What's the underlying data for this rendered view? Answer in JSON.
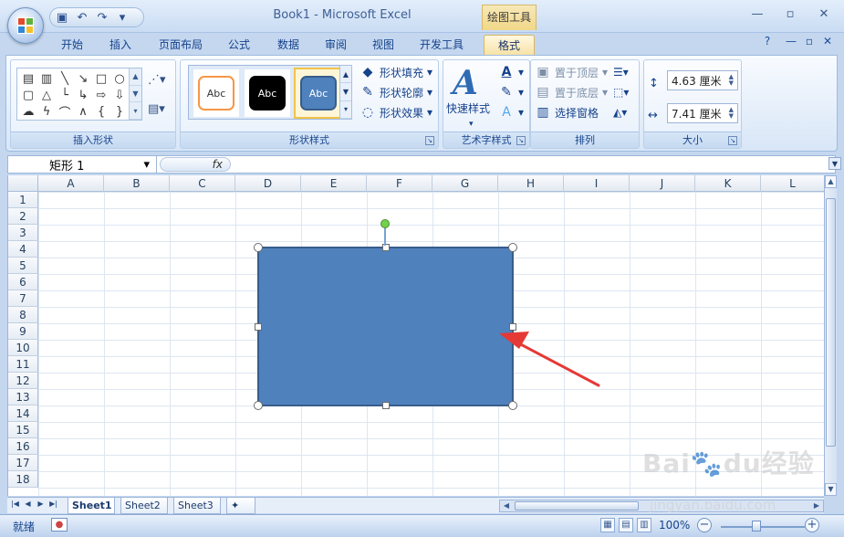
{
  "app": {
    "title": "Book1 - Microsoft Excel",
    "context_tab": "绘图工具"
  },
  "quick_access": {
    "save_icon": "save-icon",
    "undo_icon": "undo-icon",
    "redo_icon": "redo-icon",
    "customize_icon": "customize-icon"
  },
  "tabs": [
    "开始",
    "插入",
    "页面布局",
    "公式",
    "数据",
    "审阅",
    "视图",
    "开发工具",
    "格式"
  ],
  "ribbon": {
    "insert_shapes": "插入形状",
    "shape_styles": "形状样式",
    "art_styles": "艺术字样式",
    "arrange": "排列",
    "size": "大小",
    "style_samples": [
      "Abc",
      "Abc",
      "Abc"
    ],
    "fill": "形状填充",
    "outline": "形状轮廓",
    "effect": "形状效果",
    "quick_style": "快速样式",
    "bring_front": "置于顶层",
    "send_back": "置于底层",
    "selection_pane": "选择窗格",
    "height": "4.63 厘米",
    "width": "7.41 厘米"
  },
  "formula_bar": {
    "name_box": "矩形 1",
    "fx": "fx"
  },
  "sheet": {
    "columns": [
      "A",
      "B",
      "C",
      "D",
      "E",
      "F",
      "G",
      "H",
      "I",
      "J",
      "K",
      "L"
    ],
    "rows": [
      "1",
      "2",
      "3",
      "4",
      "5",
      "6",
      "7",
      "8",
      "9",
      "10",
      "11",
      "12",
      "13",
      "14",
      "15",
      "16",
      "17",
      "18"
    ],
    "tabs": [
      "Sheet1",
      "Sheet2",
      "Sheet3"
    ]
  },
  "status": {
    "ready": "就绪",
    "zoom": "100%"
  },
  "watermark": {
    "brand": "Bai",
    "brand_suffix": "du",
    "chinese": "经验",
    "url": "jingyan.baidu.com"
  },
  "colors": {
    "shape": "#4f81bd",
    "accent": "#15428b",
    "annotation_arrow": "#e53935"
  }
}
